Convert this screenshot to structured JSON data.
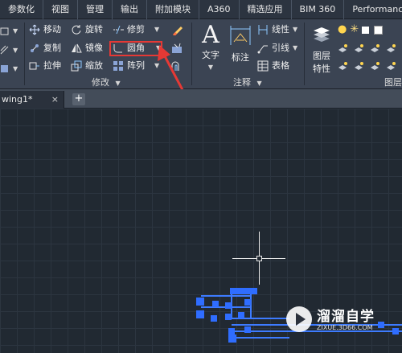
{
  "menu": {
    "tabs": [
      "参数化",
      "视图",
      "管理",
      "输出",
      "附加模块",
      "A360",
      "精选应用",
      "BIM 360",
      "Performance"
    ]
  },
  "ribbon": {
    "modify": {
      "title": "修改",
      "move": "移动",
      "rotate": "旋转",
      "trim": "修剪",
      "copy": "复制",
      "mirror": "镜像",
      "fillet": "圆角",
      "stretch": "拉伸",
      "scale": "缩放",
      "array": "阵列"
    },
    "annotation": {
      "title": "注释",
      "text": "文字",
      "dimension": "标注",
      "linear": "线性",
      "leader": "引线",
      "table": "表格"
    },
    "layers": {
      "title": "图层",
      "properties_line1": "图层",
      "properties_line2": "特性"
    }
  },
  "document": {
    "tab_label": "wing1*",
    "close_glyph": "×",
    "new_tab_glyph": "+"
  },
  "watermark": {
    "brand": "溜溜自学",
    "url": "ZIXUE.3D66.COM"
  },
  "colors": {
    "highlight": "#e53935",
    "selection_blue": "#3d7bff",
    "crosshair": "#e8e8e8"
  }
}
